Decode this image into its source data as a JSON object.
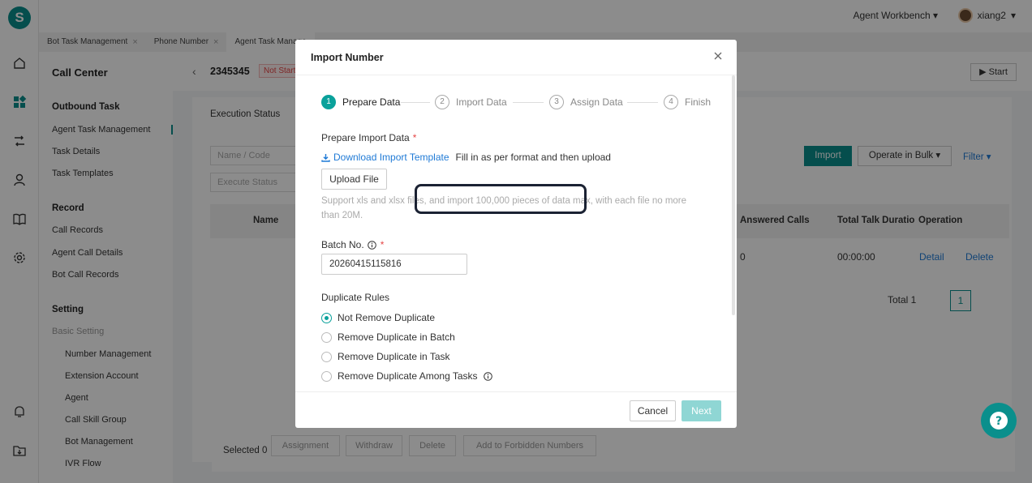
{
  "app": {
    "logo_letter": "S",
    "workbench_label": "Agent Workbench",
    "username": "xiang2"
  },
  "tabs": [
    {
      "label": "Bot Task Management"
    },
    {
      "label": "Phone Number"
    },
    {
      "label": "Agent Task Manage"
    }
  ],
  "sidebar": {
    "title": "Call Center",
    "sections": {
      "outbound": "Outbound Task",
      "record": "Record",
      "setting": "Setting",
      "basic": "Basic Setting"
    },
    "items": {
      "agent_task_mgmt": "Agent Task Management",
      "task_details": "Task Details",
      "task_templates": "Task Templates",
      "call_records": "Call Records",
      "agent_call_details": "Agent Call Details",
      "bot_call_records": "Bot Call Records",
      "number_mgmt": "Number Management",
      "extension_account": "Extension Account",
      "agent": "Agent",
      "call_skill_group": "Call Skill Group",
      "bot_mgmt": "Bot Management",
      "ivr_flow": "IVR Flow"
    }
  },
  "page": {
    "task_id": "2345345",
    "status_badge": "Not Start",
    "start_label": "Start",
    "execution_status": "Execution Status",
    "name_code_placeholder": "Name / Code",
    "execute_status_placeholder": "Execute Status",
    "import_label": "Import",
    "operate_bulk_label": "Operate in Bulk",
    "filter_label": "Filter",
    "columns": {
      "name": "Name",
      "answered": "Answered Calls",
      "talk": "Total Talk Duratio",
      "operation": "Operation"
    },
    "row": {
      "answered": "0",
      "talk": "00:00:00",
      "detail": "Detail",
      "delete": "Delete"
    },
    "total_label": "Total 1",
    "current_page": "1",
    "selected_label": "Selected 0",
    "bulk_buttons": {
      "assignment": "Assignment",
      "withdraw": "Withdraw",
      "delete": "Delete",
      "forbidden": "Add to Forbidden Numbers"
    }
  },
  "modal": {
    "title": "Import Number",
    "steps": [
      {
        "num": "1",
        "label": "Prepare Data"
      },
      {
        "num": "2",
        "label": "Import Data"
      },
      {
        "num": "3",
        "label": "Assign Data"
      },
      {
        "num": "4",
        "label": "Finish"
      }
    ],
    "prepare_label": "Prepare Import Data",
    "required_mark": "*",
    "download_link": "Download Import Template",
    "download_hint": "Fill in as per format and then upload",
    "upload_button": "Upload File",
    "support_hint": "Support xls and xlsx files, and import 100,000 pieces of data max, with each file no more than 20M.",
    "batch_label": "Batch No.",
    "batch_value": "20260415115816",
    "duplicate_label": "Duplicate Rules",
    "duplicate_options": [
      {
        "label": "Not Remove Duplicate",
        "selected": true
      },
      {
        "label": "Remove Duplicate in Batch",
        "selected": false
      },
      {
        "label": "Remove Duplicate in Task",
        "selected": false
      },
      {
        "label": "Remove Duplicate Among Tasks",
        "selected": false
      }
    ],
    "cancel_label": "Cancel",
    "next_label": "Next"
  },
  "colors": {
    "brand": "#0a8f8c",
    "active_step": "#0aa19b",
    "link": "#1f7ad6",
    "required": "#e54646"
  }
}
